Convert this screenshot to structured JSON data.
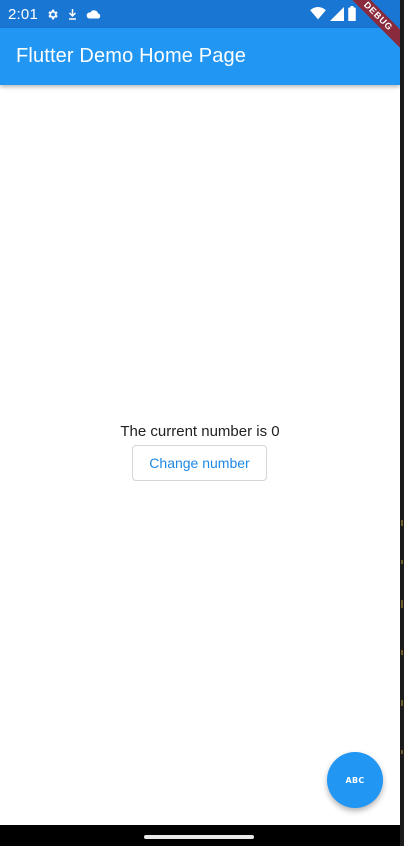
{
  "status_bar": {
    "time": "2:01",
    "background": "#1976d2",
    "left_icons": [
      "gear-icon",
      "download-icon",
      "cloud-icon"
    ],
    "right_icons": [
      "wifi-icon",
      "signal-icon",
      "battery-icon"
    ]
  },
  "app_bar": {
    "title": "Flutter Demo Home Page",
    "background": "#2196f3"
  },
  "debug_banner": {
    "label": "DEBUG",
    "color": "#8a2a3d"
  },
  "body": {
    "message": "The current number is 0",
    "button_label": "Change number",
    "button_text_color": "#1e88e5"
  },
  "fab": {
    "label": "ABC",
    "color": "#2196f3"
  },
  "nav_bar": {
    "handle": "gesture-handle"
  }
}
